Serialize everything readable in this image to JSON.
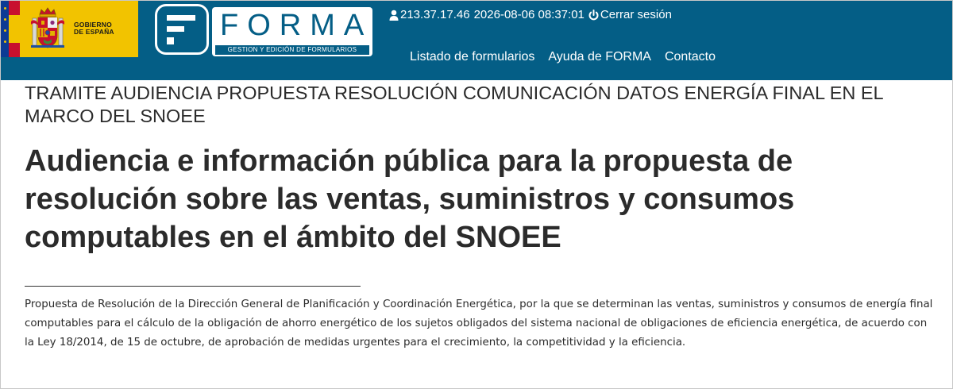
{
  "header": {
    "gov_logo_line1": "GOBIERNO",
    "gov_logo_line2": "DE ESPAÑA",
    "forma_word": "FORMA",
    "forma_subtitle": "GESTION Y EDICIÓN DE FORMULARIOS",
    "session": {
      "ip": "213.37.17.46",
      "datetime": "2026-08-06 08:37:01",
      "logout_label": "Cerrar sesión",
      "user_icon": "user-icon",
      "power_icon": "power-icon"
    },
    "nav": [
      {
        "label": "Listado de formularios"
      },
      {
        "label": "Ayuda de FORMA"
      },
      {
        "label": "Contacto"
      }
    ],
    "colors": {
      "bar": "#045e86",
      "gov_yellow": "#f2c300",
      "eu_blue": "#0c3b94",
      "spain_red": "#c8102e"
    }
  },
  "content": {
    "procedure_title": "TRAMITE AUDIENCIA PROPUESTA RESOLUCIÓN COMUNICACIÓN DATOS ENERGÍA FINAL EN EL MARCO DEL SNOEE",
    "main_title": "Audiencia e información pública para la propuesta de resolución sobre las ventas, suministros y consumos computables en el ámbito del SNOEE",
    "description": "Propuesta de Resolución de la Dirección General de Planificación y Coordinación Energética, por la que se determinan las ventas, suministros y consumos de energía final computables para el cálculo de la obligación de ahorro energético de los sujetos obligados del sistema nacional de obligaciones de eficiencia energética, de acuerdo con la Ley 18/2014, de 15 de octubre, de aprobación de medidas urgentes para el crecimiento, la competitividad y la eficiencia."
  }
}
